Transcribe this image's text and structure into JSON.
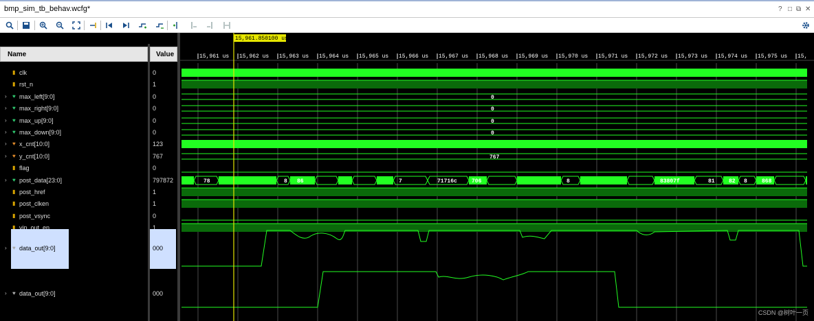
{
  "window": {
    "title": "bmp_sim_tb_behav.wcfg*",
    "controls": [
      "?",
      "□",
      "⧉",
      "✕"
    ]
  },
  "toolbar": {
    "buttons": [
      "search",
      "save",
      "zoom-in",
      "zoom-out",
      "zoom-fit",
      "goto-cursor",
      "go-to-first",
      "go-to-last",
      "add-marker",
      "prev-transition",
      "next-transition",
      "prev-marker",
      "next-marker",
      "swap-cursors"
    ],
    "settings": "gear"
  },
  "columns": {
    "name": "Name",
    "value": "Value"
  },
  "cursor": {
    "label": "15,961.850100 us"
  },
  "timeline": {
    "ticks": [
      "15,961 us",
      "15,962 us",
      "15,963 us",
      "15,964 us",
      "15,965 us",
      "15,966 us",
      "15,967 us",
      "15,968 us",
      "15,969 us",
      "15,970 us",
      "15,971 us",
      "15,972 us",
      "15,973 us",
      "15,974 us",
      "15,975 us",
      "15,"
    ]
  },
  "signals": [
    {
      "name": "clk",
      "value": "0",
      "expandable": false,
      "icon": "bit"
    },
    {
      "name": "rst_n",
      "value": "1",
      "expandable": false,
      "icon": "bit"
    },
    {
      "name": "max_left[9:0]",
      "value": "0",
      "expandable": true,
      "icon": "bus"
    },
    {
      "name": "max_right[9:0]",
      "value": "0",
      "expandable": true,
      "icon": "bus"
    },
    {
      "name": "max_up[9:0]",
      "value": "0",
      "expandable": true,
      "icon": "bus"
    },
    {
      "name": "max_down[9:0]",
      "value": "0",
      "expandable": true,
      "icon": "bus"
    },
    {
      "name": "x_cnt[10:0]",
      "value": "123",
      "expandable": true,
      "icon": "bus-orange"
    },
    {
      "name": "y_cnt[10:0]",
      "value": "767",
      "expandable": true,
      "icon": "bus-orange"
    },
    {
      "name": "flag",
      "value": "0",
      "expandable": false,
      "icon": "bit"
    },
    {
      "name": "post_data[23:0]",
      "value": "797872",
      "expandable": true,
      "icon": "bus"
    },
    {
      "name": "post_href",
      "value": "1",
      "expandable": false,
      "icon": "bit"
    },
    {
      "name": "post_clken",
      "value": "1",
      "expandable": false,
      "icon": "bit"
    },
    {
      "name": "post_vsync",
      "value": "0",
      "expandable": false,
      "icon": "bit"
    },
    {
      "name": "vip_out_en",
      "value": "1",
      "expandable": false,
      "icon": "bit"
    },
    {
      "name": "data_out[9:0]",
      "value": "000",
      "expandable": true,
      "icon": "analog"
    },
    {
      "name": "data_out[9:0]",
      "value": "000",
      "expandable": true,
      "icon": "analog"
    }
  ],
  "bus_values": {
    "max_left": "0",
    "max_right": "0",
    "max_up": "0",
    "max_down": "0",
    "y_cnt": "767",
    "post_data": [
      "78",
      "8",
      "86",
      "7",
      "71716c",
      "706",
      "8",
      "83807f",
      "81",
      "82",
      "8",
      "868"
    ]
  },
  "watermark": "CSDN @树叶一页"
}
